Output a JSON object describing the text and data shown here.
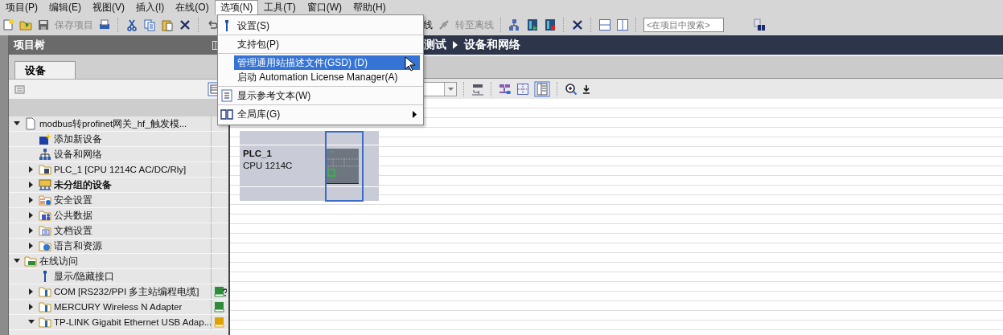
{
  "menu_bar": [
    {
      "label": "项目(P)",
      "selected": false
    },
    {
      "label": "编辑(E)",
      "selected": false
    },
    {
      "label": "视图(V)",
      "selected": false
    },
    {
      "label": "插入(I)",
      "selected": false
    },
    {
      "label": "在线(O)",
      "selected": false
    },
    {
      "label": "选项(N)",
      "selected": true
    },
    {
      "label": "工具(T)",
      "selected": false
    },
    {
      "label": "窗口(W)",
      "selected": false
    },
    {
      "label": "帮助(H)",
      "selected": false
    }
  ],
  "toolbar": {
    "save": {
      "label": "保存项目",
      "disabled": true
    },
    "online_label": "线",
    "offline": {
      "label": "转至离线",
      "disabled": true
    },
    "search": {
      "placeholder": "<在项目中搜索>"
    }
  },
  "options_menu": [
    [
      {
        "label": "设置(S)",
        "kind": "wrench",
        "selected": false,
        "submenu": false
      }
    ],
    [
      {
        "label": "支持包(P)",
        "kind": "plain",
        "selected": false,
        "submenu": false
      }
    ],
    [
      {
        "label": "管理通用站描述文件(GSD) (D)",
        "kind": "plain",
        "selected": true,
        "submenu": false
      },
      {
        "label": "启动 Automation License Manager(A)",
        "kind": "plain",
        "selected": false,
        "submenu": false
      }
    ],
    [
      {
        "label": "显示参考文本(W)",
        "kind": "reference",
        "selected": false,
        "submenu": false
      }
    ],
    [
      {
        "label": "全局库(G)",
        "kind": "book",
        "selected": false,
        "submenu": true
      }
    ]
  ],
  "project_tree": {
    "title": "项目树",
    "tabs": [
      {
        "label": "设备",
        "selected": true
      }
    ],
    "items": [
      {
        "label": "modbus转profinet网关_hf_触发模...",
        "kind": "project",
        "bold": false,
        "expanded": true,
        "children": [
          {
            "label": "添加新设备",
            "kind": "add",
            "bold": false
          },
          {
            "label": "设备和网络",
            "kind": "network",
            "bold": false
          },
          {
            "label": "PLC_1 [CPU 1214C AC/DC/Rly]",
            "kind": "plc",
            "bold": false,
            "expanded": false
          },
          {
            "label": "未分组的设备",
            "kind": "group",
            "bold": true,
            "expanded": false
          },
          {
            "label": "安全设置",
            "kind": "security",
            "bold": false,
            "expanded": false
          },
          {
            "label": "公共数据",
            "kind": "common",
            "bold": false,
            "expanded": false
          },
          {
            "label": "文档设置",
            "kind": "docs",
            "bold": false,
            "expanded": false
          },
          {
            "label": "语言和资源",
            "kind": "language",
            "bold": false,
            "expanded": false
          }
        ]
      },
      {
        "label": "在线访问",
        "kind": "online",
        "bold": false,
        "expanded": true,
        "children": [
          {
            "label": "显示/隐藏接口",
            "kind": "interface",
            "bold": false
          },
          {
            "label": "COM [RS232/PPI 多主站编程电缆]",
            "kind": "adapter",
            "bold": false,
            "expanded": false,
            "color": "#2e8b3a",
            "query": true
          },
          {
            "label": "MERCURY Wireless N Adapter",
            "kind": "adapter",
            "bold": false,
            "expanded": false,
            "color": "#2e8b3a",
            "query": false
          },
          {
            "label": "TP-LINK Gigabit Ethernet USB Adap...",
            "kind": "adapter",
            "bold": false,
            "expanded": true,
            "color": "#e0a000",
            "query": false
          }
        ]
      }
    ]
  },
  "editor": {
    "breadcrumb": [
      "测试",
      "设备和网络"
    ],
    "device": {
      "name": "PLC_1",
      "type": "CPU 1214C",
      "selected": true
    }
  }
}
